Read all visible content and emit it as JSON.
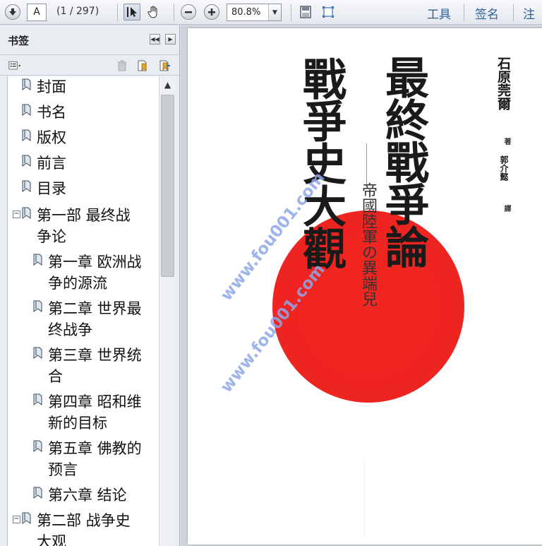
{
  "toolbar": {
    "page_current": "A",
    "page_count": "(1 / 297)",
    "zoom": "80.8%",
    "links": [
      "工具",
      "签名",
      "注释"
    ]
  },
  "panel": {
    "title": "书签"
  },
  "bookmarks": [
    {
      "label": "封面"
    },
    {
      "label": "书名"
    },
    {
      "label": "版权"
    },
    {
      "label": "前言"
    },
    {
      "label": "目录"
    },
    {
      "label": "第一部  最终战",
      "label2": "争论"
    },
    {
      "label": "第一章  欧洲战",
      "label2": "争的源流"
    },
    {
      "label": "第二章  世界最",
      "label2": "终战争"
    },
    {
      "label": "第三章  世界统",
      "label2": "合"
    },
    {
      "label": "第四章  昭和维",
      "label2": "新的目标"
    },
    {
      "label": "第五章  佛教的",
      "label2": "预言"
    },
    {
      "label": "第六章  结论"
    },
    {
      "label": "第二部  战争史",
      "label2": "大观"
    }
  ],
  "cover": {
    "title_right": "最終戰爭論",
    "title_left": "戰爭史大觀",
    "subtitle": "帝國陸軍の異端兒",
    "author": "石原莞爾",
    "author_role": "著",
    "translator": "郭介懿",
    "translator_role": "譯",
    "watermark": "www.fou001.com"
  },
  "colors": {
    "sun": "#ee2420",
    "link": "#2f5f9a",
    "watermark": "#8fa7e8"
  }
}
